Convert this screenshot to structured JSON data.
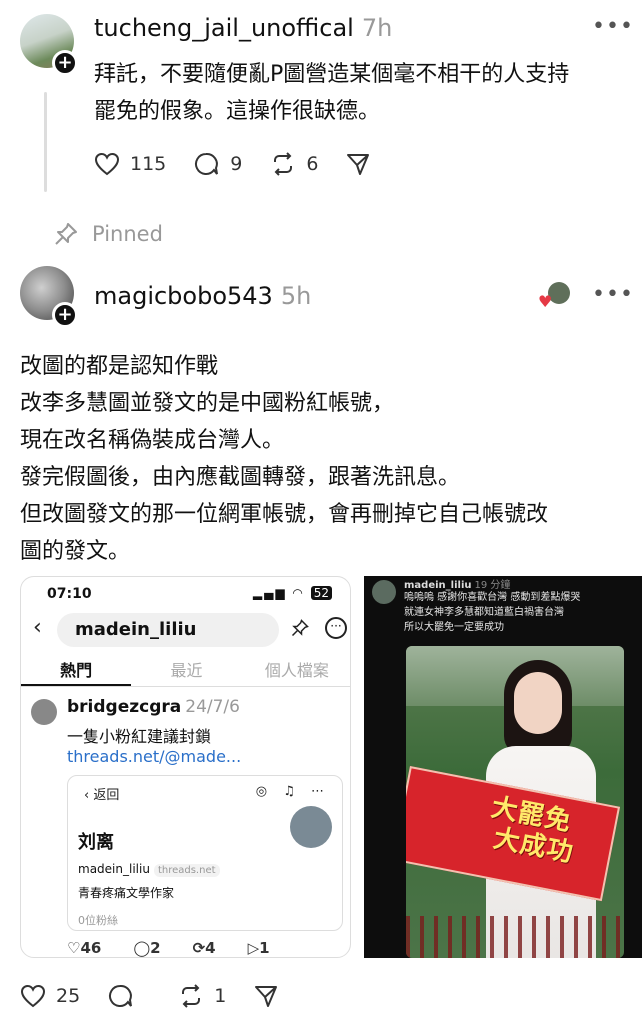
{
  "post1": {
    "username": "tucheng_jail_unoffical",
    "time": "7h",
    "text_line1": "拜託，不要隨便亂P圖營造某個毫不相干的人支持",
    "text_line2": "罷免的假象。這操作很缺德。",
    "likes": "115",
    "comments": "9",
    "reposts": "6"
  },
  "pinned_label": "Pinned",
  "post2": {
    "username": "magicbobo543",
    "time": "5h",
    "lines": [
      "改圖的都是認知作戰",
      "改李多慧圖並發文的是中國粉紅帳號，",
      "現在改名稱偽裝成台灣人。",
      "發完假圖後，由內應截圖轉發，跟著洗訊息。",
      "但改圖發文的那一位網軍帳號，會再刪掉它自己帳號改",
      "圖的發文。"
    ],
    "likes": "25",
    "reposts": "1"
  },
  "shot1": {
    "status_time": "07:10",
    "status_battery": "52",
    "search_value": "madein_liliu",
    "tabs": [
      "熱門",
      "最近",
      "個人檔案"
    ],
    "post_user": "bridgezcgra",
    "post_time": "24/7/6",
    "post_text": "一隻小粉紅建議封鎖",
    "post_link": "threads.net/@made...",
    "card_back": "返回",
    "card_name": "刘离",
    "card_handle": "madein_liliu",
    "card_host": "threads.net",
    "card_bio": "青春疼痛文學作家",
    "card_followers": "0位粉絲",
    "stat_likes": "46",
    "stat_comments": "2",
    "stat_reposts": "4",
    "stat_shares": "1"
  },
  "shot2": {
    "user": "madein_liliu",
    "time": "19 分鐘",
    "line1": "嗚嗚嗚 感謝你喜歡台灣 感動到差點爆哭",
    "line2": "就連女神李多慧都知道藍白禍害台灣",
    "line3": "所以大罷免一定要成功",
    "banner_line1": "大罷免",
    "banner_line2": "大成功"
  }
}
